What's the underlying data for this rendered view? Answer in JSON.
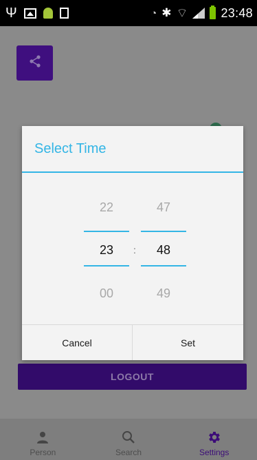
{
  "status_bar": {
    "time": "23:48",
    "icons": {
      "left": [
        "usb-icon",
        "image-icon",
        "android-icon",
        "document-icon"
      ],
      "right": [
        "eye-icon",
        "bluetooth-icon",
        "wifi-icon",
        "signal-icon",
        "battery-icon"
      ]
    },
    "colors": {
      "battery": "#7dc300"
    }
  },
  "app": {
    "share_icon": "share-icon",
    "logout_label": "LOGOUT",
    "accent_color": "#3f0f7f"
  },
  "dialog": {
    "title": "Select Time",
    "accent_color": "#33b5e5",
    "hours": {
      "prev": "22",
      "current": "23",
      "next": "00"
    },
    "separator": ":",
    "minutes": {
      "prev": "47",
      "current": "48",
      "next": "49"
    },
    "cancel_label": "Cancel",
    "set_label": "Set"
  },
  "bottom_nav": {
    "items": [
      {
        "label": "Person",
        "icon": "person-icon",
        "active": false
      },
      {
        "label": "Search",
        "icon": "search-icon",
        "active": false
      },
      {
        "label": "Settings",
        "icon": "gear-icon",
        "active": true
      }
    ]
  }
}
